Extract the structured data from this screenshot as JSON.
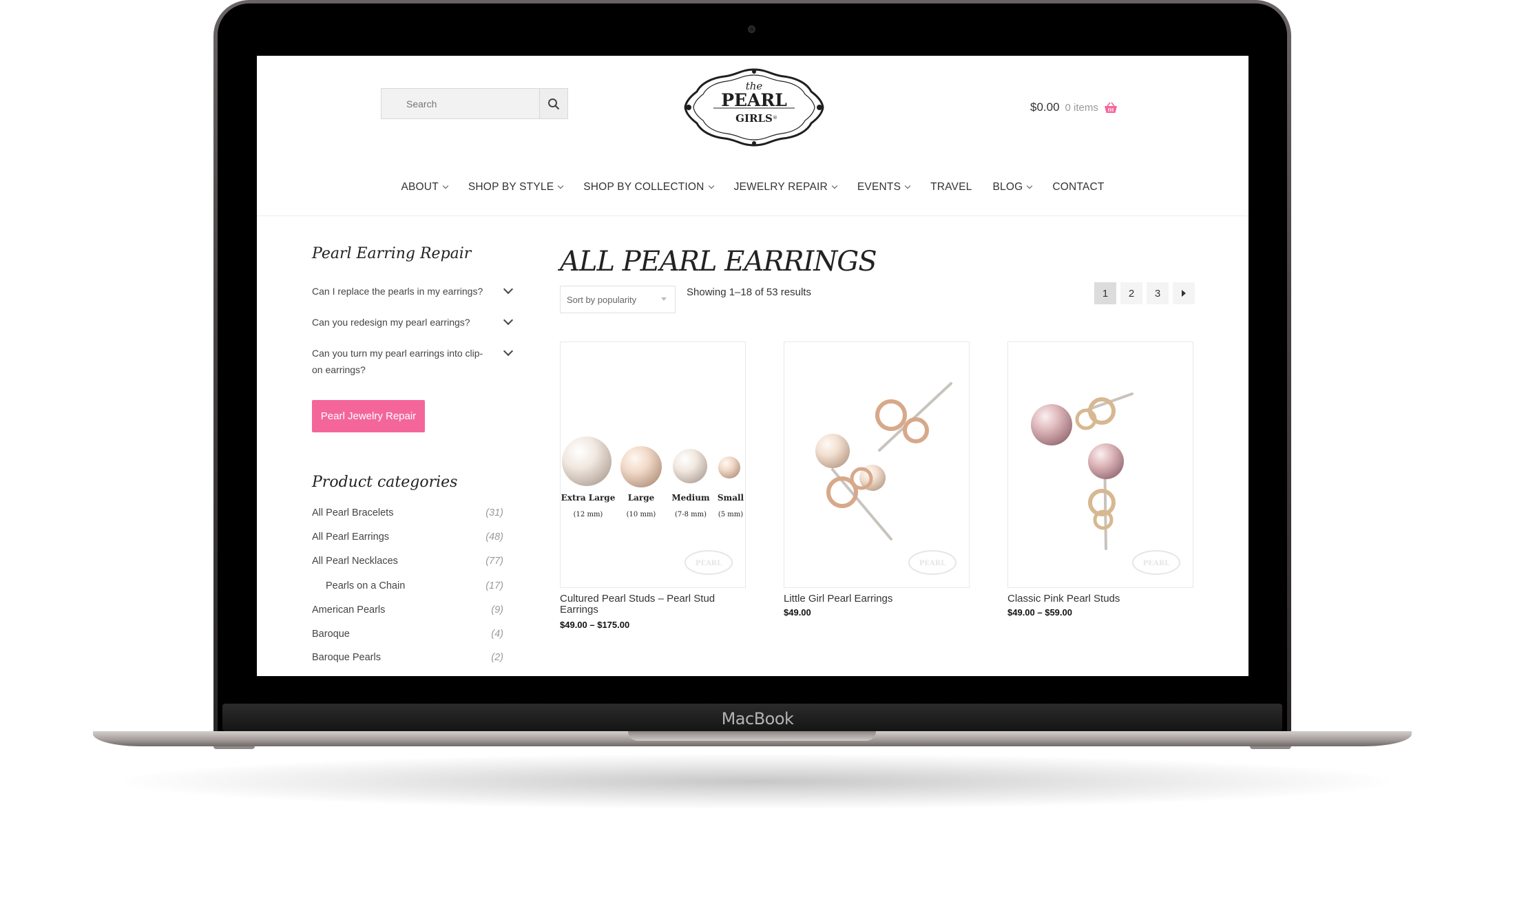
{
  "device": {
    "brand": "MacBook"
  },
  "header": {
    "search": {
      "placeholder": "Search"
    },
    "logo": {
      "small": "the",
      "line1": "PEARL",
      "line2": "GIRLS",
      "mark": "®"
    },
    "cart": {
      "total": "$0.00",
      "items": "0 items"
    }
  },
  "nav": [
    {
      "label": "ABOUT",
      "dropdown": true
    },
    {
      "label": "SHOP BY STYLE",
      "dropdown": true
    },
    {
      "label": "SHOP BY COLLECTION",
      "dropdown": true
    },
    {
      "label": "JEWELRY REPAIR",
      "dropdown": true
    },
    {
      "label": "EVENTS",
      "dropdown": true
    },
    {
      "label": "TRAVEL",
      "dropdown": false
    },
    {
      "label": "BLOG",
      "dropdown": true
    },
    {
      "label": "CONTACT",
      "dropdown": false
    }
  ],
  "sidebar": {
    "faq_title": "Pearl Earring Repair",
    "faqs": [
      "Can I replace the pearls in my earrings?",
      "Can you redesign my pearl earrings?",
      "Can you turn my pearl earrings into clip-on earrings?"
    ],
    "repair_button": "Pearl Jewelry Repair",
    "categories_title": "Product categories",
    "categories": [
      {
        "name": "All Pearl Bracelets",
        "count": "(31)"
      },
      {
        "name": "All Pearl Earrings",
        "count": "(48)"
      },
      {
        "name": "All Pearl Necklaces",
        "count": "(77)"
      },
      {
        "name": "Pearls on a Chain",
        "count": "(17)"
      },
      {
        "name": "American Pearls",
        "count": "(9)"
      },
      {
        "name": "Baroque",
        "count": "(4)"
      },
      {
        "name": "Baroque Pearls",
        "count": "(2)"
      }
    ]
  },
  "main": {
    "title": "ALL PEARL EARRINGS",
    "sort": "Sort by popularity",
    "result_count": "Showing 1–18 of 53 results",
    "pages": [
      "1",
      "2",
      "3"
    ],
    "current_page": "1",
    "products": [
      {
        "name": "Cultured Pearl Studs – Pearl Stud Earrings",
        "price": "$49.00 – $175.00",
        "sizes": [
          {
            "label": "Extra Large",
            "mm": "(12 mm)"
          },
          {
            "label": "Large",
            "mm": "(10 mm)"
          },
          {
            "label": "Medium",
            "mm": "(7-8 mm)"
          },
          {
            "label": "Small",
            "mm": "(5 mm)"
          }
        ]
      },
      {
        "name": "Little Girl Pearl Earrings",
        "price": "$49.00"
      },
      {
        "name": "Classic Pink Pearl Studs",
        "price": "$49.00 – $59.00"
      }
    ],
    "watermark": "PEARL"
  },
  "colors": {
    "accent_pink": "#f4669a",
    "text": "#333333",
    "muted": "#999999"
  }
}
